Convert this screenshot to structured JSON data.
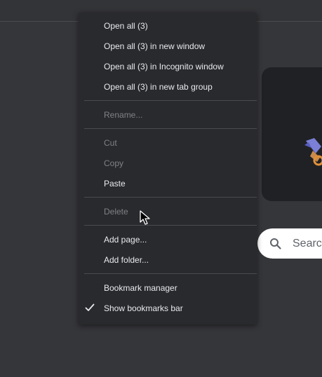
{
  "menu": {
    "items": [
      {
        "label": "Open all (3)",
        "enabled": true
      },
      {
        "label": "Open all (3) in new window",
        "enabled": true
      },
      {
        "label": "Open all (3) in Incognito window",
        "enabled": true
      },
      {
        "label": "Open all (3) in new tab group",
        "enabled": true
      },
      {
        "label": "Rename...",
        "enabled": false
      },
      {
        "label": "Cut",
        "enabled": false
      },
      {
        "label": "Copy",
        "enabled": false
      },
      {
        "label": "Paste",
        "enabled": true
      },
      {
        "label": "Delete",
        "enabled": false
      },
      {
        "label": "Add page...",
        "enabled": true
      },
      {
        "label": "Add folder...",
        "enabled": true
      },
      {
        "label": "Bookmark manager",
        "enabled": true
      },
      {
        "label": "Show bookmarks bar",
        "enabled": true,
        "checked": true
      }
    ]
  },
  "search": {
    "placeholder": "Search"
  },
  "colors": {
    "background": "#35363a",
    "menu_background": "#292a2d",
    "text_enabled": "#e8eaed",
    "text_disabled": "#808185",
    "separator": "#4a4b4f"
  },
  "icons": {
    "check": "check-icon",
    "search": "search-icon",
    "cursor": "mouse-cursor-icon"
  }
}
